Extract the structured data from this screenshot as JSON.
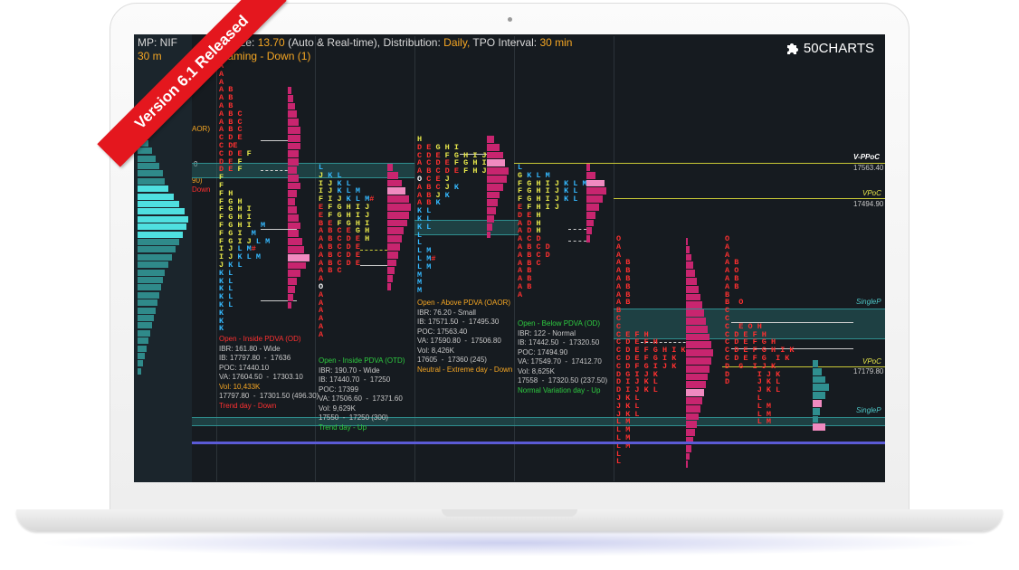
{
  "banner": {
    "text": "Version 6.1 Released"
  },
  "logo": {
    "text": "50CHARTS"
  },
  "header": {
    "line1_prefix": "MP: NIF",
    "line1_tposize_label": "POSize:",
    "line1_tposize_value": "13.70",
    "line1_mid": "(Auto & Real-time),  Distribution:",
    "line1_distribution": "Daily,",
    "line1_interval_label": "TPO Interval:",
    "line1_interval": "30 min",
    "line2_a": "30 m",
    "line2_b": "e framing - Down (1)"
  },
  "left_labels": {
    "oaor": "AOR)",
    "zero": "0",
    "ninety": "90)",
    "down": "Down"
  },
  "colors": {
    "red": "#ff3030",
    "yellow": "#e8e84a",
    "orange": "#f5a623",
    "cyan": "#35b9ff",
    "white": "#ffffff",
    "magenta": "#d8247a",
    "green": "#2ecc40"
  },
  "sessions": [
    {
      "stats": [
        "Open - Inside PDVA (OD)",
        "IBR: 161.80 - Wide",
        "IB: 17797.80  -  17636",
        "POC: 17440.10",
        "VA: 17604.50  -  17303.10",
        "Vol: 10,433K",
        "17797.80  -  17301.50 (496.30)",
        "Trend day - Down"
      ]
    },
    {
      "stats": [
        "Open - Inside PDVA (OTD)",
        "IBR: 190.70 - Wide",
        "IB: 17440.70  -  17250",
        "POC: 17399",
        "VA: 17506.60  -  17371.60",
        "Vol: 9,629K",
        "17550  -  17250 (300)",
        "Trend day - Up"
      ]
    },
    {
      "stats": [
        "Open - Above PDVA (OAOR)",
        "IBR: 76.20 - Small",
        "IB: 17571.50  -  17495.30",
        "POC: 17563.40",
        "VA: 17590.80  -  17506.80",
        "Vol: 8,426K",
        "17605  -  17360 (245)",
        "Neutral - Extreme day - Down"
      ]
    },
    {
      "stats": [
        "Open - Below PDVA (OD)",
        "IBR: 122 - Normal",
        "IB: 17442.50  -  17320.50",
        "POC: 17494.90",
        "VA: 17549.70  -  17412.70",
        "Vol: 8,625K",
        "17558  -  17320.50 (237.50)",
        "Normal Variation day - Up"
      ]
    }
  ],
  "levels": {
    "vppoc_label": "V-PPoC",
    "vppoc_value": "17563.40",
    "vpoc1_label": "VPoC",
    "vpoc1_value": "17494.90",
    "singlep1": "SingleP",
    "vpoc2_label": "VPoC",
    "vpoc2_value": "17179.80",
    "singlep2": "SingleP"
  },
  "tpo": {
    "s1": [
      "A",
      "A",
      "A",
      "A B",
      "A B",
      "A B",
      "A B C",
      "A B C",
      "A B C",
      "C D E",
      "C DE",
      "C D E F",
      "D E F",
      "D E F",
      "F",
      "F",
      "F H",
      "F G H",
      "F G H I",
      "F G H I",
      "F G H I  M",
      "F G I  M",
      "F G I J L M",
      "I J L M#",
      "I J K L M",
      "J K L",
      "K L",
      "K L",
      "K L",
      "K L",
      "K L",
      "K",
      "K",
      "K"
    ],
    "s2": [
      "L",
      "J K L",
      "I J K L",
      "I J K L M",
      "F I J K L M#",
      "E F G H I J",
      "E F G H I J",
      "B E F G H I",
      "A B C E G H",
      "A B C D E H",
      "A B C D E",
      "A B C D E",
      "A B C D E",
      "A B C",
      "A",
      "O",
      "A",
      "A",
      "A",
      "A",
      "A",
      "A"
    ],
    "s3": [
      "H",
      "D E G H I",
      "C D E F G H I J",
      "A C D E F G H I J",
      "A B C D E F H J",
      "O C E J",
      "A B C J K",
      "A B J K",
      "A B K",
      "K L",
      "K L",
      "K L",
      "L",
      "L",
      "L M",
      "L M#",
      "L M",
      "M",
      "M",
      "M"
    ],
    "s4": [
      "L",
      "G K L M",
      "F G H I J K L M#",
      "F G H I J K L",
      "F G H I J K L",
      "E F H I J",
      "D E H",
      "A D H",
      "A D H",
      "A C D",
      "A B C D",
      "A B C D",
      "A B C",
      "A B",
      "A B",
      "A B",
      "A"
    ]
  }
}
